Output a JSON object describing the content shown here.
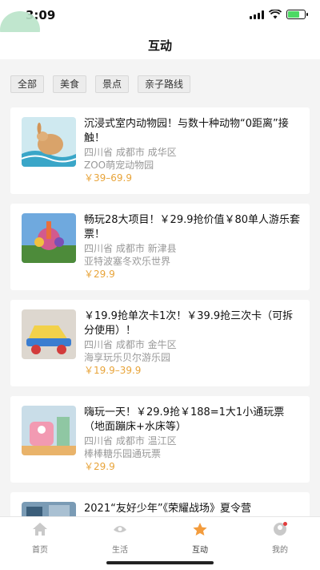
{
  "status": {
    "time": "3:09"
  },
  "header": {
    "title": "互动"
  },
  "filters": [
    "全部",
    "美食",
    "景点",
    "亲子路线"
  ],
  "cards": [
    {
      "title": "沉浸式室内动物园！与数十种动物“0距离”接触！",
      "location": "四川省 成都市 成华区",
      "venue": "ZOO萌宠动物园",
      "price": "￥39–69.9"
    },
    {
      "title": "畅玩28大项目！￥29.9抢价值￥80单人游乐套票！",
      "location": "四川省 成都市 新津县",
      "venue": "亚特波塞冬欢乐世界",
      "price": "￥29.9"
    },
    {
      "title": "￥19.9抢单次卡1次！￥39.9抢三次卡（可拆分使用）！",
      "location": "四川省 成都市 金牛区",
      "venue": "海享玩乐贝尔游乐园",
      "price": "￥19.9–39.9"
    },
    {
      "title": "嗨玩一天！￥29.9抢￥188=1大1小通玩票（地面蹦床+水床等）",
      "location": "四川省 成都市 温江区",
      "venue": "棒棒糖乐园通玩票",
      "price": "￥29.9"
    },
    {
      "title": "2021“友好少年”《荣耀战场》夏令营"
    }
  ],
  "tabs": [
    {
      "label": "首页",
      "icon": "home-icon"
    },
    {
      "label": "生活",
      "icon": "life-icon"
    },
    {
      "label": "互动",
      "icon": "interact-icon",
      "active": true
    },
    {
      "label": "我的",
      "icon": "profile-icon"
    }
  ],
  "colors": {
    "accent": "#f39c3d",
    "price": "#e8a43a"
  }
}
